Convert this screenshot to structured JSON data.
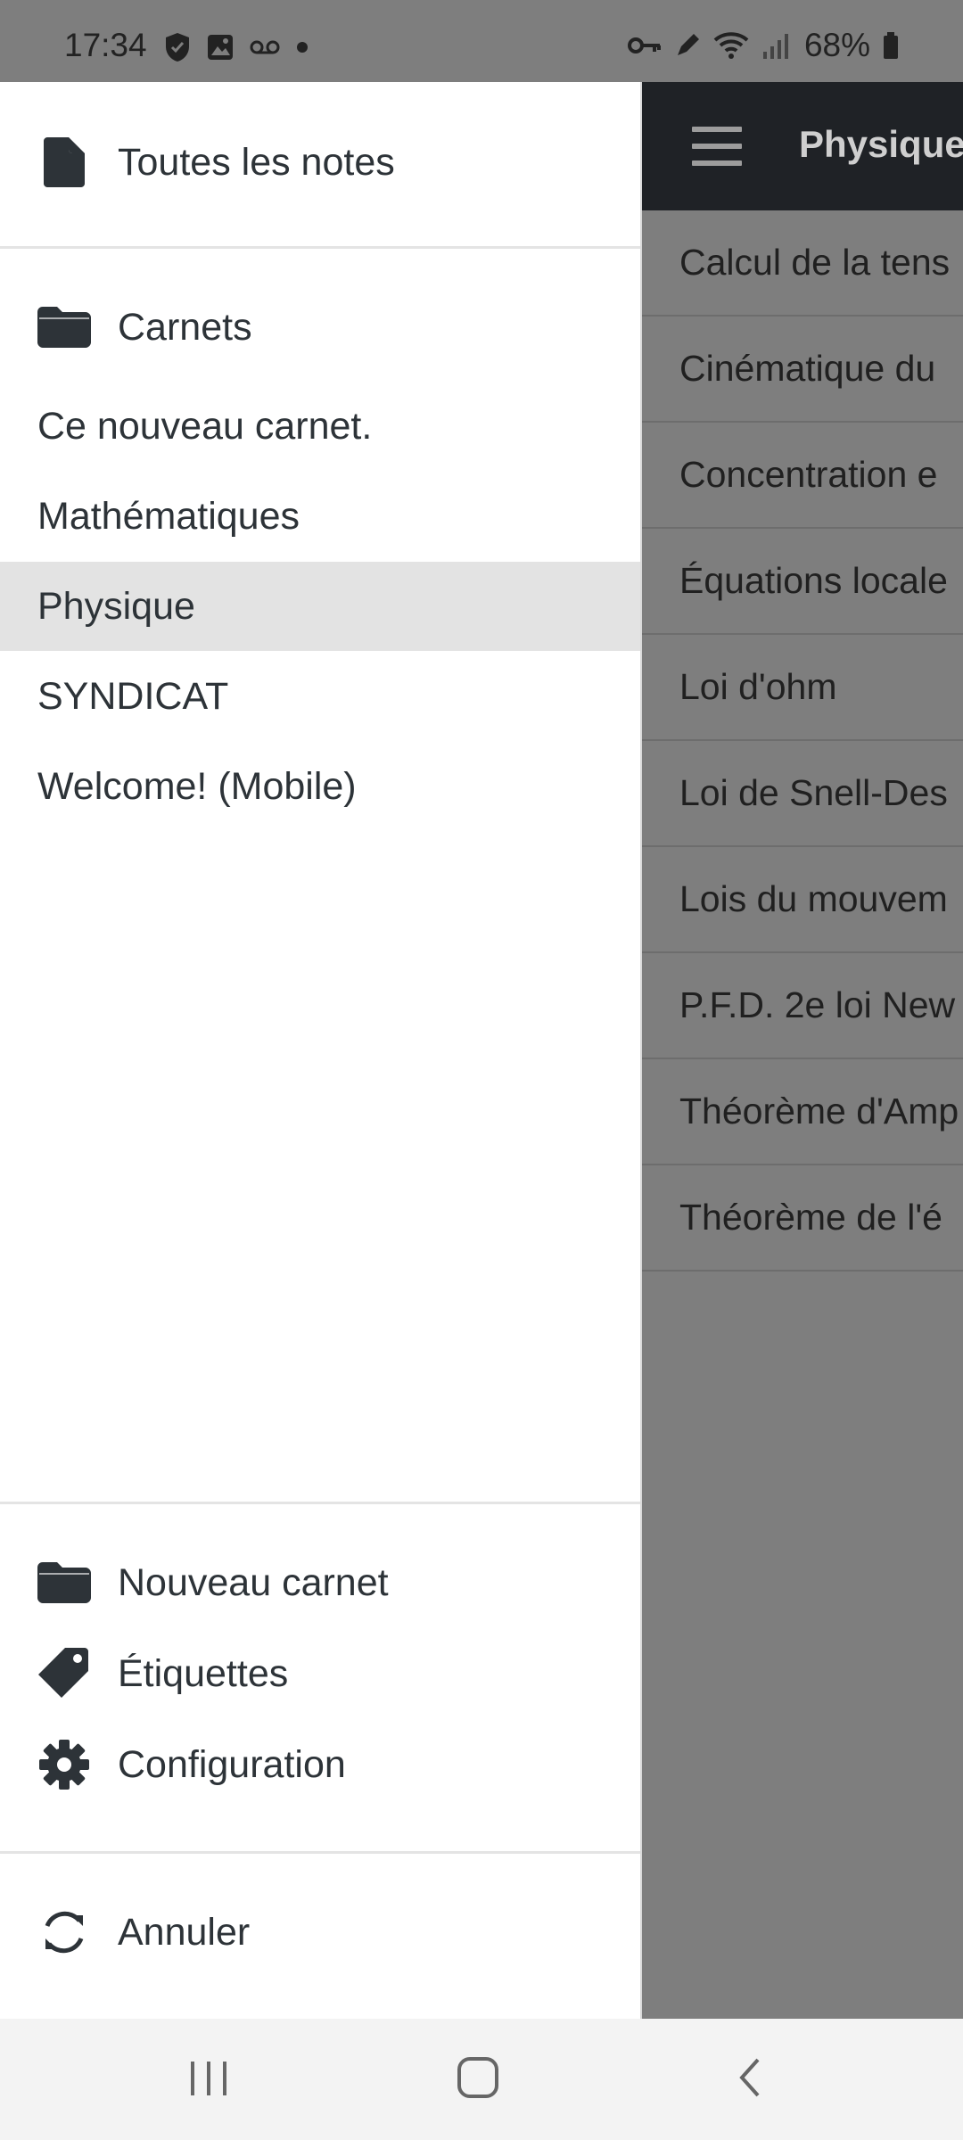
{
  "status_bar": {
    "time": "17:34",
    "battery": "68%",
    "left_icons": [
      "shield-icon",
      "image-icon",
      "voicemail-icon",
      "dot-icon"
    ],
    "right_icons": [
      "key-icon",
      "pen-icon",
      "wifi-icon",
      "signal-icon",
      "battery-icon"
    ]
  },
  "app_header": {
    "title": "Physique",
    "menu_icon": "hamburger-icon"
  },
  "notes": [
    "Calcul de la tens",
    "Cinématique du",
    "Concentration e",
    "Équations locale",
    "Loi d'ohm",
    "Loi de Snell-Des",
    "Lois du mouvem",
    "P.F.D. 2e loi New",
    "Théorème d'Amp",
    "Théorème de l'é"
  ],
  "drawer": {
    "all_notes": {
      "label": "Toutes les notes",
      "icon": "file-icon"
    },
    "notebooks_header": {
      "label": "Carnets",
      "icon": "folder-icon"
    },
    "notebooks": [
      {
        "label": "Ce nouveau carnet.",
        "selected": false
      },
      {
        "label": "Mathématiques",
        "selected": false
      },
      {
        "label": "Physique",
        "selected": true
      },
      {
        "label": "SYNDICAT",
        "selected": false
      },
      {
        "label": "Welcome! (Mobile)",
        "selected": false
      }
    ],
    "actions": [
      {
        "label": "Nouveau carnet",
        "icon": "folder-icon"
      },
      {
        "label": "Étiquettes",
        "icon": "tag-icon"
      },
      {
        "label": "Configuration",
        "icon": "gear-icon"
      }
    ],
    "sync": {
      "label": "Annuler",
      "icon": "sync-icon"
    }
  },
  "nav_bar": {
    "buttons": [
      "recent-apps-icon",
      "home-icon",
      "back-icon"
    ]
  },
  "colors": {
    "header_bg": "#1f2226",
    "drawer_bg": "#ffffff",
    "selected_bg": "#e3e3e3",
    "scrim": "#7e7e7e",
    "text": "#2d3338"
  }
}
